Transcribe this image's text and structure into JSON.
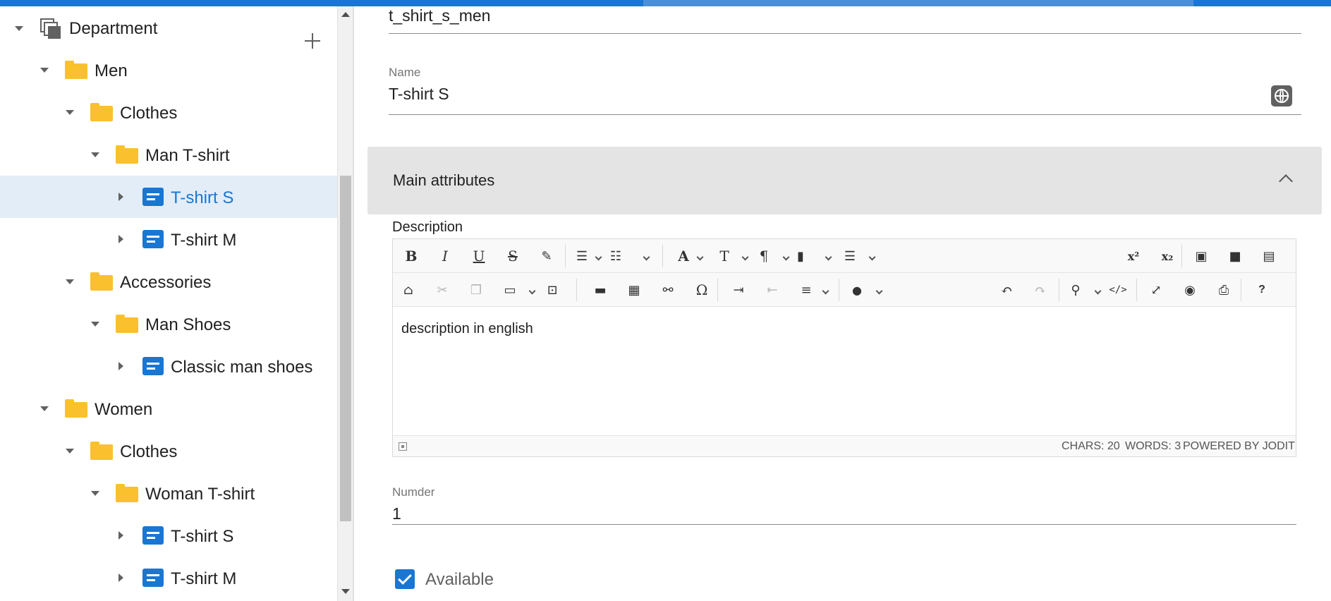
{
  "sidebar": {
    "root": {
      "label": "Department",
      "icon": "collection-icon",
      "add_icon": "add-icon"
    },
    "items": [
      {
        "label": "Men",
        "type": "folder",
        "expanded": true
      },
      {
        "label": "Clothes",
        "type": "folder",
        "expanded": true
      },
      {
        "label": "Man T-shirt",
        "type": "folder",
        "expanded": true
      },
      {
        "label": "T-shirt S",
        "type": "item",
        "expanded": false,
        "selected": true
      },
      {
        "label": "T-shirt M",
        "type": "item",
        "expanded": false
      },
      {
        "label": "Accessories",
        "type": "folder",
        "expanded": true
      },
      {
        "label": "Man Shoes",
        "type": "folder",
        "expanded": true
      },
      {
        "label": "Classic man shoes",
        "type": "item",
        "expanded": false
      },
      {
        "label": "Women",
        "type": "folder",
        "expanded": true
      },
      {
        "label": "Clothes",
        "type": "folder",
        "expanded": true
      },
      {
        "label": "Woman T-shirt",
        "type": "folder",
        "expanded": true
      },
      {
        "label": "T-shirt S",
        "type": "item",
        "expanded": false
      },
      {
        "label": "T-shirt M",
        "type": "item",
        "expanded": false
      }
    ]
  },
  "form": {
    "code_value": "t_shirt_s_men",
    "name_label": "Name",
    "name_value": "T-shirt S",
    "section_title": "Main attributes",
    "description_label": "Description",
    "description_text": "description in english",
    "editor_status": {
      "chars": "CHARS: 20",
      "words": "WORDS: 3",
      "powered": "POWERED BY JODIT"
    },
    "number_label": "Numder",
    "number_value": "1",
    "available_label": "Available",
    "available_checked": true
  },
  "colors": {
    "accent": "#1976d2",
    "folder": "#fbc02d",
    "selected_bg": "#e3edf8",
    "section_bg": "#e4e4e4"
  }
}
